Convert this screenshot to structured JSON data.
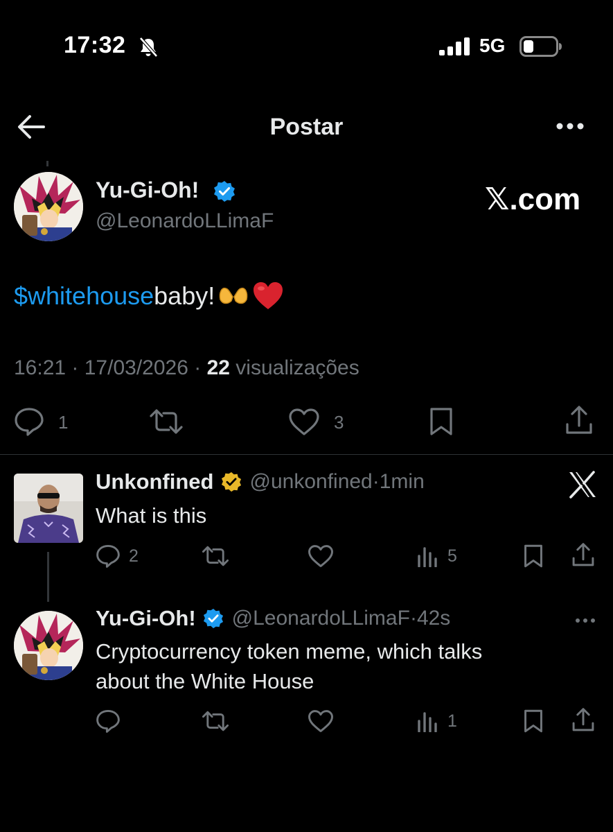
{
  "status_bar": {
    "time": "17:32",
    "network": "5G"
  },
  "header": {
    "title": "Postar"
  },
  "main_post": {
    "author_name": "Yu-Gi-Oh!",
    "handle": "@LeonardoLLimaF",
    "watermark": "𝕏.com",
    "cashtag": "$whitehouse",
    "text_rest": " baby!",
    "time": "16:21",
    "date": "17/03/2026",
    "views": "22",
    "views_label": "visualizações",
    "replies": "1",
    "likes": "3"
  },
  "replies": [
    {
      "author_name": "Unkonfined",
      "handle": "@unkonfined",
      "age": "1min",
      "text": "What is this",
      "replies": "2",
      "views": "5"
    },
    {
      "author_name": "Yu-Gi-Oh!",
      "handle": "@LeonardoLLimaF",
      "age": "42s",
      "text_line1": "Cryptocurrency token meme, which talks",
      "text_line2": "about the White House",
      "views": "1"
    }
  ],
  "colors": {
    "background": "#000000",
    "accent": "#1d9bf0",
    "text_primary": "#e7e9ea",
    "text_secondary": "#71767b",
    "verified_blue": "#1d9bf0",
    "verified_gold": "#e8b829",
    "divider": "#2f3336"
  },
  "icons": [
    "back-arrow-icon",
    "more-icon",
    "verified-badge-icon",
    "reply-icon",
    "repost-icon",
    "like-icon",
    "bookmark-icon",
    "share-icon",
    "views-icon",
    "x-logo-icon",
    "bell-off-icon",
    "signal-icon",
    "battery-icon"
  ]
}
